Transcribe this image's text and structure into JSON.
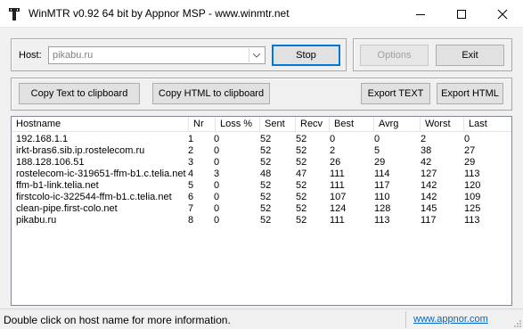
{
  "window": {
    "title": "WinMTR v0.92 64 bit by Appnor MSP - www.winmtr.net"
  },
  "host": {
    "label": "Host:",
    "value": "pikabu.ru"
  },
  "buttons": {
    "stop": "Stop",
    "options": "Options",
    "exit": "Exit",
    "copy_text": "Copy Text to clipboard",
    "copy_html": "Copy HTML to clipboard",
    "export_text": "Export TEXT",
    "export_html": "Export HTML"
  },
  "table": {
    "columns": [
      "Hostname",
      "Nr",
      "Loss %",
      "Sent",
      "Recv",
      "Best",
      "Avrg",
      "Worst",
      "Last"
    ],
    "rows": [
      [
        "192.168.1.1",
        "1",
        "0",
        "52",
        "52",
        "0",
        "0",
        "2",
        "0"
      ],
      [
        "irkt-bras6.sib.ip.rostelecom.ru",
        "2",
        "0",
        "52",
        "52",
        "2",
        "5",
        "38",
        "27"
      ],
      [
        "188.128.106.51",
        "3",
        "0",
        "52",
        "52",
        "26",
        "29",
        "42",
        "29"
      ],
      [
        "rostelecom-ic-319651-ffm-b1.c.telia.net",
        "4",
        "3",
        "48",
        "47",
        "111",
        "114",
        "127",
        "113"
      ],
      [
        "ffm-b1-link.telia.net",
        "5",
        "0",
        "52",
        "52",
        "111",
        "117",
        "142",
        "120"
      ],
      [
        "firstcolo-ic-322544-ffm-b1.c.telia.net",
        "6",
        "0",
        "52",
        "52",
        "107",
        "110",
        "142",
        "109"
      ],
      [
        "clean-pipe.first-colo.net",
        "7",
        "0",
        "52",
        "52",
        "124",
        "128",
        "145",
        "125"
      ],
      [
        "pikabu.ru",
        "8",
        "0",
        "52",
        "52",
        "111",
        "113",
        "117",
        "113"
      ]
    ]
  },
  "status": {
    "message": "Double click on host name for more information.",
    "link": "www.appnor.com"
  },
  "colors": {
    "accent": "#0078d7",
    "link": "#0066cc"
  },
  "icons": [
    "app-icon",
    "minimize-icon",
    "maximize-icon",
    "close-icon",
    "dropdown-arrow-icon",
    "size-grip-icon"
  ]
}
